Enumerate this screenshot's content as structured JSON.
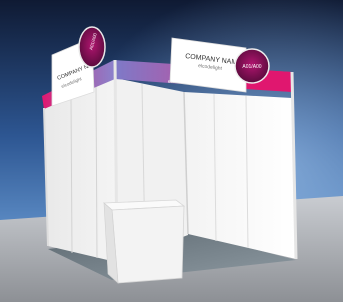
{
  "booth": {
    "front_sign": {
      "company_name": "COMPANY NAME",
      "tagline": "elcodelight",
      "badge": "A01/A00"
    },
    "side_sign": {
      "company_name": "COMPANY NAME",
      "tagline": "elcodelight",
      "badge": "A01/A00"
    },
    "fascia_text": "elcodelight",
    "colors": {
      "accent": "#d6166f",
      "accent_dark": "#8b0f4f",
      "lavender": "#8a7fc8",
      "wall": "#f7f7f7",
      "frame": "#d9d9d9",
      "carpet": "#7d8a91",
      "backdrop_top": "#1a2a4a",
      "backdrop_mid": "#3f70b4"
    }
  }
}
